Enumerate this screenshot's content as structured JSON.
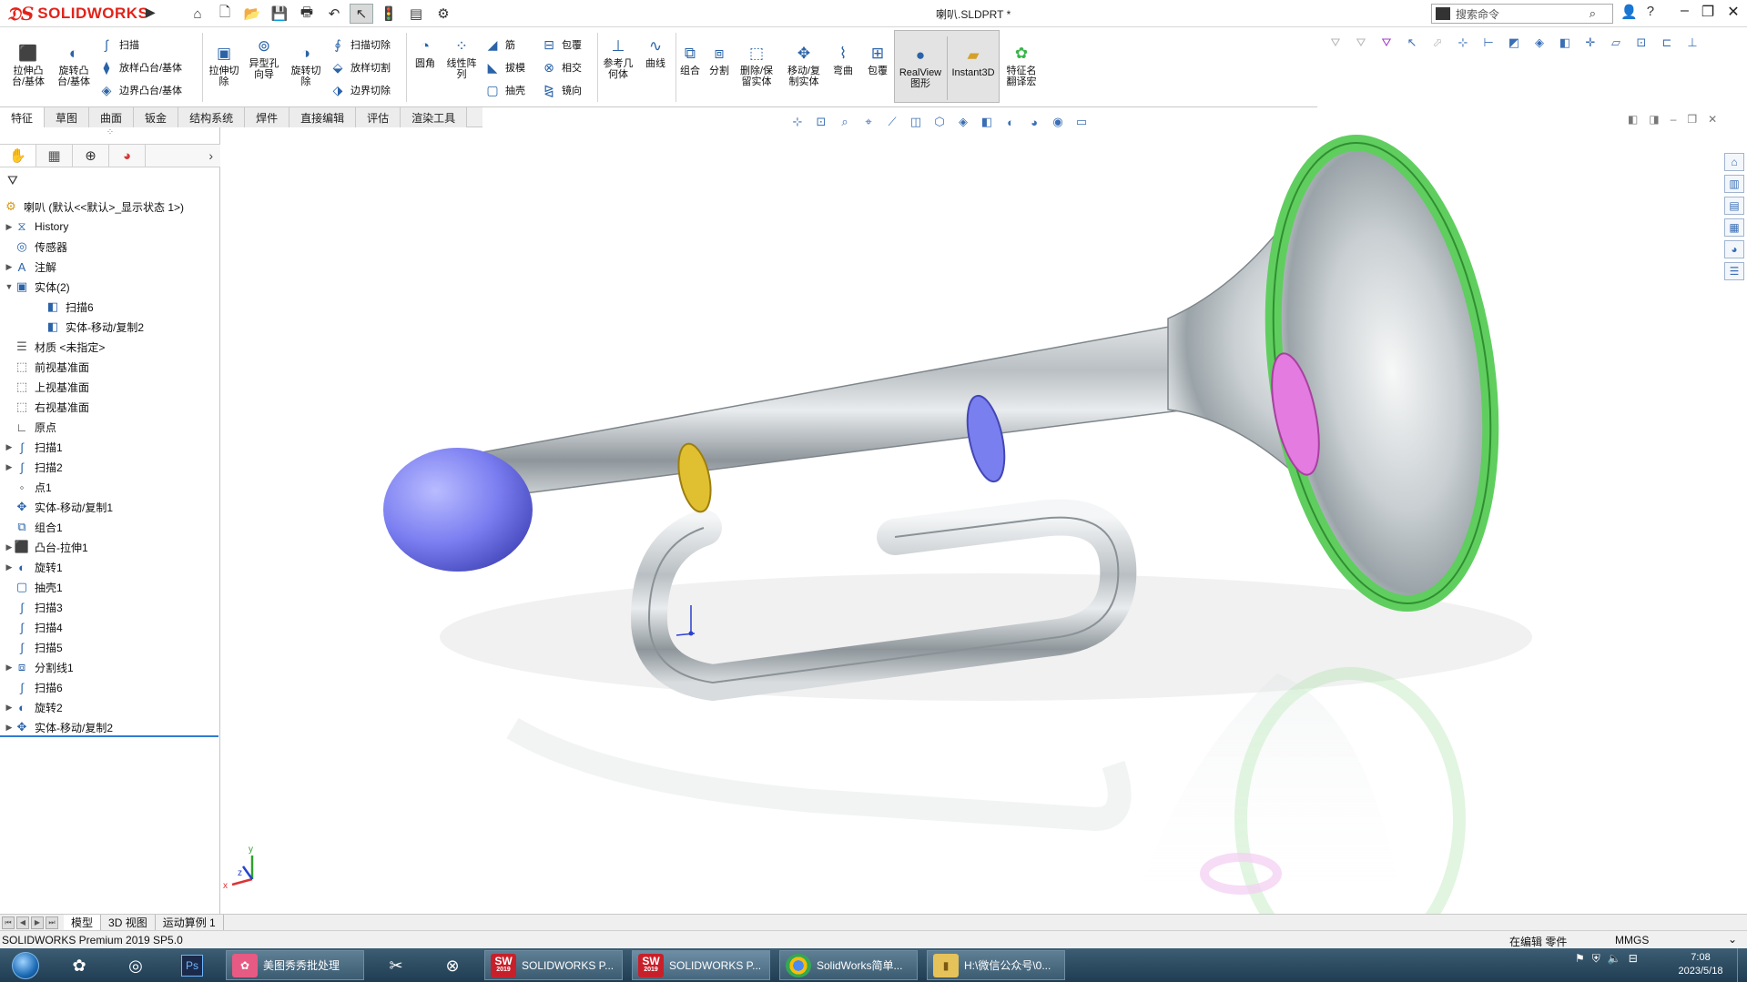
{
  "app": {
    "logo_text": "SOLIDWORKS",
    "doc_title": "喇叭.SLDPRT *",
    "search_placeholder": "搜索命令"
  },
  "commands": {
    "extrude_boss": "拉伸凸台/基体",
    "revolve_boss": "旋转凸台/基体",
    "sweep": "扫描",
    "loft_boss": "放样凸台/基体",
    "boundary_boss": "边界凸台/基体",
    "extrude_cut": "拉伸切除",
    "hole_wizard": "异型孔向导",
    "revolve_cut": "旋转切除",
    "sweep_cut": "扫描切除",
    "loft_cut": "放样切割",
    "boundary_cut": "边界切除",
    "fillet": "圆角",
    "linear_pattern": "线性阵列",
    "rib": "筋",
    "draft": "拔模",
    "shell": "抽壳",
    "wrap": "包覆",
    "intersect": "相交",
    "mirror": "镜向",
    "ref_geometry": "参考几何体",
    "curves": "曲线",
    "combine": "组合",
    "split": "分割",
    "delete_keep_body": "删除/保留实体",
    "move_copy_body": "移动/复制实体",
    "flex": "弯曲",
    "wrap2": "包覆",
    "realview": "RealView图形",
    "instant3d": "Instant3D",
    "feature_translate": "特征名翻译宏"
  },
  "tabs": [
    {
      "label": "特征"
    },
    {
      "label": "草图"
    },
    {
      "label": "曲面"
    },
    {
      "label": "钣金"
    },
    {
      "label": "结构系统"
    },
    {
      "label": "焊件"
    },
    {
      "label": "直接编辑"
    },
    {
      "label": "评估"
    },
    {
      "label": "渲染工具"
    }
  ],
  "tree": {
    "root": "喇叭 (默认<<默认>_显示状态 1>)",
    "items": [
      {
        "label": "History",
        "icon": "history-icon"
      },
      {
        "label": "传感器",
        "icon": "sensor-icon"
      },
      {
        "label": "注解",
        "icon": "annotation-icon"
      },
      {
        "label": "实体(2)",
        "icon": "solid-bodies-icon"
      },
      {
        "label": "扫描6",
        "icon": "body-icon"
      },
      {
        "label": "实体-移动/复制2",
        "icon": "body-icon"
      },
      {
        "label": "材质 <未指定>",
        "icon": "material-icon"
      },
      {
        "label": "前视基准面",
        "icon": "plane-icon"
      },
      {
        "label": "上视基准面",
        "icon": "plane-icon"
      },
      {
        "label": "右视基准面",
        "icon": "plane-icon"
      },
      {
        "label": "原点",
        "icon": "origin-icon"
      },
      {
        "label": "扫描1",
        "icon": "sweep-icon"
      },
      {
        "label": "扫描2",
        "icon": "sweep-icon"
      },
      {
        "label": "点1",
        "icon": "point-icon"
      },
      {
        "label": "实体-移动/复制1",
        "icon": "move-body-icon"
      },
      {
        "label": "组合1",
        "icon": "combine-icon"
      },
      {
        "label": "凸台-拉伸1",
        "icon": "extrude-icon"
      },
      {
        "label": "旋转1",
        "icon": "revolve-icon"
      },
      {
        "label": "抽壳1",
        "icon": "shell-icon"
      },
      {
        "label": "扫描3",
        "icon": "sweep-icon"
      },
      {
        "label": "扫描4",
        "icon": "sweep-icon"
      },
      {
        "label": "扫描5",
        "icon": "sweep-icon"
      },
      {
        "label": "分割线1",
        "icon": "split-line-icon"
      },
      {
        "label": "扫描6",
        "icon": "sweep-icon"
      },
      {
        "label": "旋转2",
        "icon": "revolve-icon"
      },
      {
        "label": "实体-移动/复制2",
        "icon": "move-body-icon"
      }
    ]
  },
  "model_tabs": [
    {
      "label": "模型"
    },
    {
      "label": "3D 视图"
    },
    {
      "label": "运动算例 1"
    }
  ],
  "status": {
    "version": "SOLIDWORKS Premium 2019 SP5.0",
    "editing": "在编辑 零件",
    "units": "MMGS"
  },
  "taskbar": {
    "buttons": [
      {
        "label": "美图秀秀批处理"
      },
      {
        "label": "SOLIDWORKS P..."
      },
      {
        "label": "SOLIDWORKS P..."
      },
      {
        "label": "SolidWorks简单..."
      },
      {
        "label": "H:\\微信公众号\\0..."
      }
    ],
    "badge_sw": "SW",
    "badge_year": "2019",
    "ps_icon_text": "Ps",
    "time": "7:08",
    "date": "2023/5/18"
  },
  "triad": {
    "x": "x",
    "y": "y",
    "z": "z"
  },
  "colors": {
    "accent": "#2a63a8",
    "mouthpiece": "#7b7ef0",
    "ring_yellow": "#e0c030",
    "ring_blue": "#7a7ff0",
    "ring_pink": "#e37be0",
    "ring_green": "#5fce5f"
  }
}
